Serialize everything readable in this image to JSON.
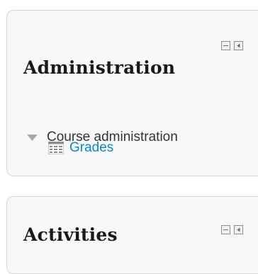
{
  "admin_block": {
    "title": "Administration",
    "course_admin_label": "Course administration",
    "grades_label": "Grades"
  },
  "activities_block": {
    "title": "Activities"
  },
  "icons": {
    "hide": "minus-box-icon",
    "dock": "dock-box-icon",
    "expand": "triangle-down-icon",
    "grades": "grades-table-icon"
  },
  "colors": {
    "link": "#0a88c7",
    "block_bg": "#f8f8f8",
    "border": "#d6d6d6"
  }
}
